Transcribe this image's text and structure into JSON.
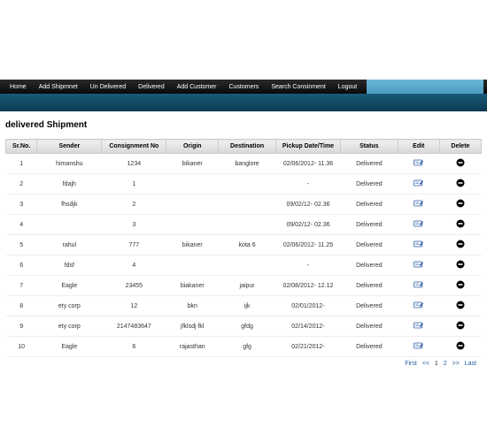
{
  "nav": [
    "Home",
    "Add Shipmnet",
    "Un Delivered",
    "Delivered",
    "Add Customer",
    "Customers",
    "Search Consinment",
    "Logout"
  ],
  "page_title": "delivered Shipment",
  "columns": [
    "Sr.No.",
    "Sender",
    "Consignment No",
    "Origin",
    "Destination",
    "Pickup Date/Time",
    "Status",
    "Edit",
    "Delete"
  ],
  "rows": [
    {
      "sr": "1",
      "sender": "himanshu",
      "cons": "1234",
      "origin": "bikaner",
      "dest": "banglore",
      "dt": "02/06/2012- 11.36",
      "status": "Delivered"
    },
    {
      "sr": "2",
      "sender": "fdajh",
      "cons": "1",
      "origin": "",
      "dest": "",
      "dt": "-",
      "status": "Delivered"
    },
    {
      "sr": "3",
      "sender": "fhsdjk",
      "cons": "2",
      "origin": "",
      "dest": "",
      "dt": "09/02/12- 02.36",
      "status": "Delivered"
    },
    {
      "sr": "4",
      "sender": "",
      "cons": "3",
      "origin": "",
      "dest": "",
      "dt": "09/02/12- 02.36",
      "status": "Delivered"
    },
    {
      "sr": "5",
      "sender": "rahul",
      "cons": "777",
      "origin": "bikaner",
      "dest": "kota 6",
      "dt": "02/06/2012- 11.25",
      "status": "Delivered"
    },
    {
      "sr": "6",
      "sender": "fdsf",
      "cons": "4",
      "origin": "",
      "dest": "",
      "dt": "-",
      "status": "Delivered"
    },
    {
      "sr": "7",
      "sender": "Eagle",
      "cons": "23455",
      "origin": "biakaner",
      "dest": "jaipur",
      "dt": "02/08/2012- 12.12",
      "status": "Delivered"
    },
    {
      "sr": "8",
      "sender": "ety corp",
      "cons": "12",
      "origin": "bkn",
      "dest": "ijk",
      "dt": "02/01/2012-",
      "status": "Delivered"
    },
    {
      "sr": "9",
      "sender": "ety corp",
      "cons": "2147483647",
      "origin": "jfklsdj fkl",
      "dest": "gfdg",
      "dt": "02/14/2012-",
      "status": "Delivered"
    },
    {
      "sr": "10",
      "sender": "Eagle",
      "cons": "6",
      "origin": "rajasthan",
      "dest": "gfg",
      "dt": "02/21/2012-",
      "status": "Delivered"
    }
  ],
  "pager": {
    "first": "First",
    "prev": "<<",
    "pages": [
      "1",
      "2"
    ],
    "next": ">>",
    "last": "Last",
    "current": "1"
  },
  "icons": {
    "edit": "edit-icon",
    "delete": "delete-icon"
  }
}
